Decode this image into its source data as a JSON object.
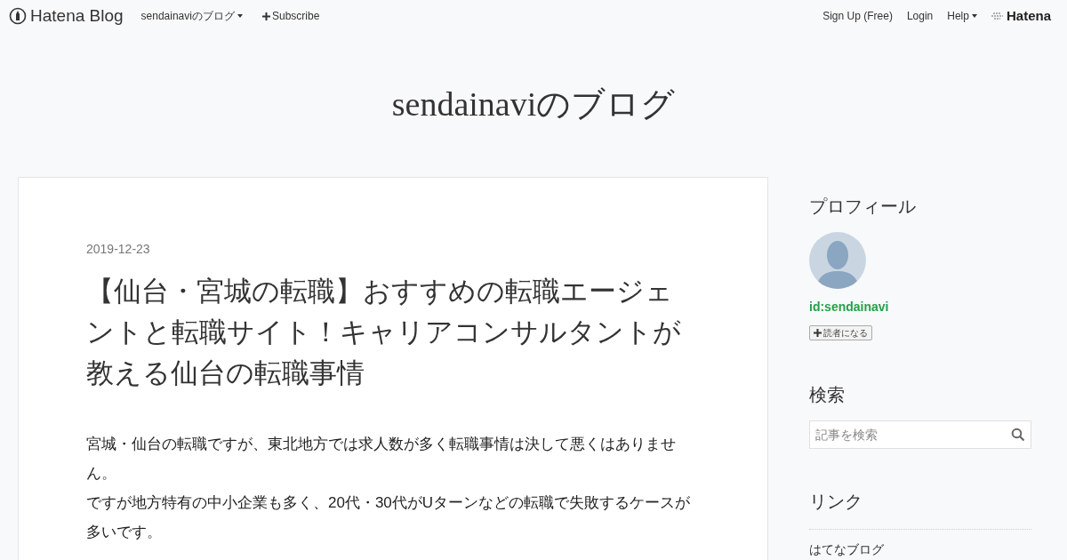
{
  "navbar": {
    "logo": "Hatena Blog",
    "blog_menu": "sendainaviのブログ",
    "subscribe": "Subscribe",
    "links": [
      "Sign Up (Free)",
      "Login"
    ],
    "help": "Help",
    "brand": "Hatena"
  },
  "blog_title": "sendainaviのブログ",
  "entry": {
    "date": "2019-12-23",
    "title": "【仙台・宮城の転職】おすすめの転職エージェントと転職サイト！キャリアコンサルタントが教える仙台の転職事情",
    "paragraphs": [
      "宮城・仙台の転職ですが、東北地方では求人数が多く転職事情は決して悪くはありません。",
      "ですが地方特有の中小企業も多く、20代・30代がUターンなどの転職で失敗するケースが多いです。"
    ]
  },
  "sidebar": {
    "profile": {
      "heading": "プロフィール",
      "user_id": "id:sendainavi",
      "follow_button": "読者になる"
    },
    "search": {
      "heading": "検索",
      "placeholder": "記事を検索"
    },
    "links": {
      "heading": "リンク",
      "items": [
        "はてなブログ"
      ]
    }
  }
}
